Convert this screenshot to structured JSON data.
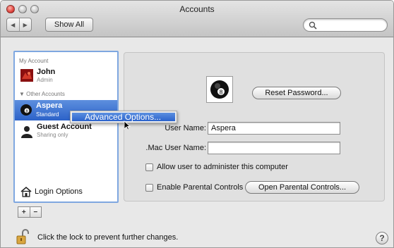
{
  "window": {
    "title": "Accounts"
  },
  "toolbar": {
    "back_glyph": "◀",
    "forward_glyph": "▶",
    "show_all_label": "Show All",
    "search_placeholder": ""
  },
  "sidebar": {
    "my_account_label": "My Account",
    "my_account": {
      "name": "John",
      "role": "Admin"
    },
    "other_accounts_label": "▼ Other Accounts",
    "other_accounts": [
      {
        "name": "Aspera",
        "role": "Standard"
      },
      {
        "name": "Guest Account",
        "role": "Sharing only"
      }
    ],
    "login_options_label": "Login Options",
    "add_glyph": "+",
    "remove_glyph": "−"
  },
  "context_menu": {
    "item": "Advanced Options..."
  },
  "detail": {
    "reset_password_label": "Reset Password...",
    "user_name_label": "User Name:",
    "user_name_value": "Aspera",
    "mac_user_name_label": ".Mac User Name:",
    "mac_user_name_value": "",
    "allow_admin_label": "Allow user to administer this computer",
    "allow_admin_checked": false,
    "parental_controls_label": "Enable Parental Controls",
    "parental_controls_checked": false,
    "open_parental_controls_label": "Open Parental Controls..."
  },
  "footer": {
    "lock_text": "Click the lock to prevent further changes.",
    "help_glyph": "?"
  },
  "colors": {
    "selection": "#2c62c8",
    "focus_ring": "#7fa7e0",
    "window_bg": "#e8e8e8"
  }
}
